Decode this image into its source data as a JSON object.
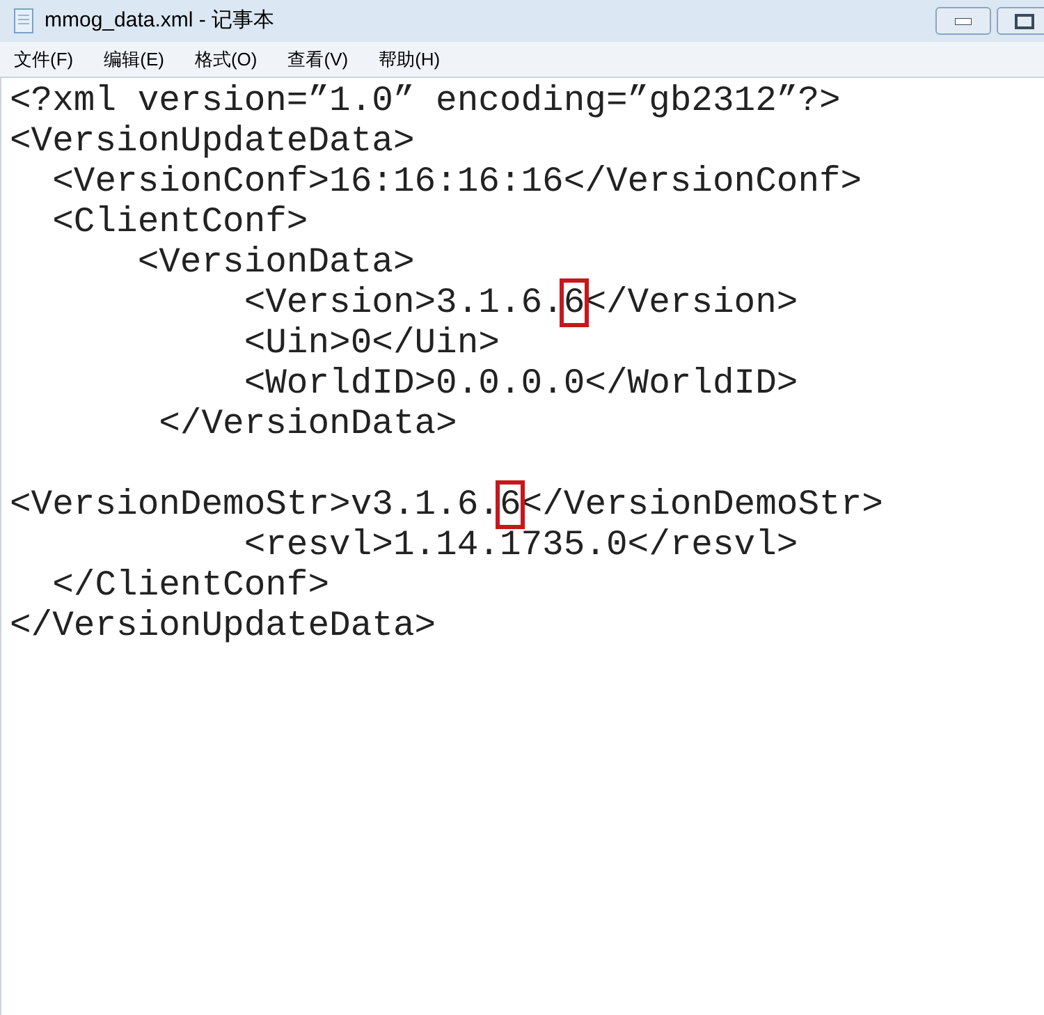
{
  "window": {
    "title": "mmog_data.xml - 记事本"
  },
  "menu": [
    "文件(F)",
    "编辑(E)",
    "格式(O)",
    "查看(V)",
    "帮助(H)"
  ],
  "lines": [
    {
      "segments": [
        {
          "text": "<?xml version=”1.0” encoding=”gb2312”?>",
          "highlighted": false
        }
      ]
    },
    {
      "segments": [
        {
          "text": "<VersionUpdateData>",
          "highlighted": false
        }
      ]
    },
    {
      "segments": [
        {
          "text": "  <VersionConf>16:16:16:16</VersionConf>",
          "highlighted": false
        }
      ]
    },
    {
      "segments": [
        {
          "text": "  <ClientConf>",
          "highlighted": false
        }
      ]
    },
    {
      "segments": [
        {
          "text": "      <VersionData>",
          "highlighted": false
        }
      ]
    },
    {
      "segments": [
        {
          "text": "           <Version>3.1.6.",
          "highlighted": false
        },
        {
          "text": "6",
          "highlighted": true
        },
        {
          "text": "</Version>",
          "highlighted": false
        }
      ]
    },
    {
      "segments": [
        {
          "text": "           <Uin>0</Uin>",
          "highlighted": false
        }
      ]
    },
    {
      "segments": [
        {
          "text": "           <WorldID>0.0.0.0</WorldID>",
          "highlighted": false
        }
      ]
    },
    {
      "segments": [
        {
          "text": "       </VersionData>",
          "highlighted": false
        }
      ]
    },
    {
      "kind": "blank"
    },
    {
      "segments": [
        {
          "text": "<VersionDemoStr>v3.1.6.",
          "highlighted": false
        },
        {
          "text": "6",
          "highlighted": true
        },
        {
          "text": "</VersionDemoStr>",
          "highlighted": false
        }
      ]
    },
    {
      "segments": [
        {
          "text": "           <resvl>1.14.1735.0</resvl>",
          "highlighted": false
        }
      ]
    },
    {
      "segments": [
        {
          "text": "  </ClientConf>",
          "highlighted": false
        }
      ]
    },
    {
      "segments": [
        {
          "text": "</VersionUpdateData>",
          "highlighted": false
        }
      ]
    }
  ]
}
